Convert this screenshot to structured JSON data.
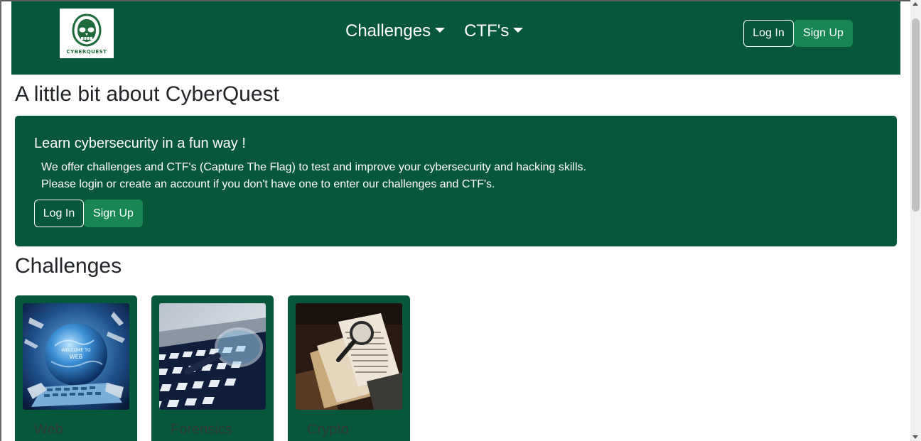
{
  "brand": {
    "logo_text": "CYBERQUEST",
    "logo_icon": "hooded-skull-icon"
  },
  "nav": {
    "menu": [
      {
        "label": "Challenges"
      },
      {
        "label": "CTF's"
      }
    ],
    "login_label": "Log In",
    "signup_label": "Sign Up"
  },
  "about": {
    "title": "A little bit about CyberQuest",
    "heading": "Learn cybersecurity in a fun way !",
    "line1": "We offer challenges and CTF's (Capture The Flag) to test and improve your cybersecurity and hacking skills.",
    "line2": "Please login or create an account if you don't have one to enter our challenges and CTF's.",
    "login_label": "Log In",
    "signup_label": "Sign Up"
  },
  "challenges": {
    "title": "Challenges",
    "cards": [
      {
        "label": "Web",
        "image": "globe-keyboard-image"
      },
      {
        "label": "Forensics",
        "image": "magnifier-keyboard-image"
      },
      {
        "label": "Crypto",
        "image": "magnifier-papers-image"
      }
    ]
  },
  "colors": {
    "primary_green": "#07573a",
    "button_green": "#198754"
  }
}
